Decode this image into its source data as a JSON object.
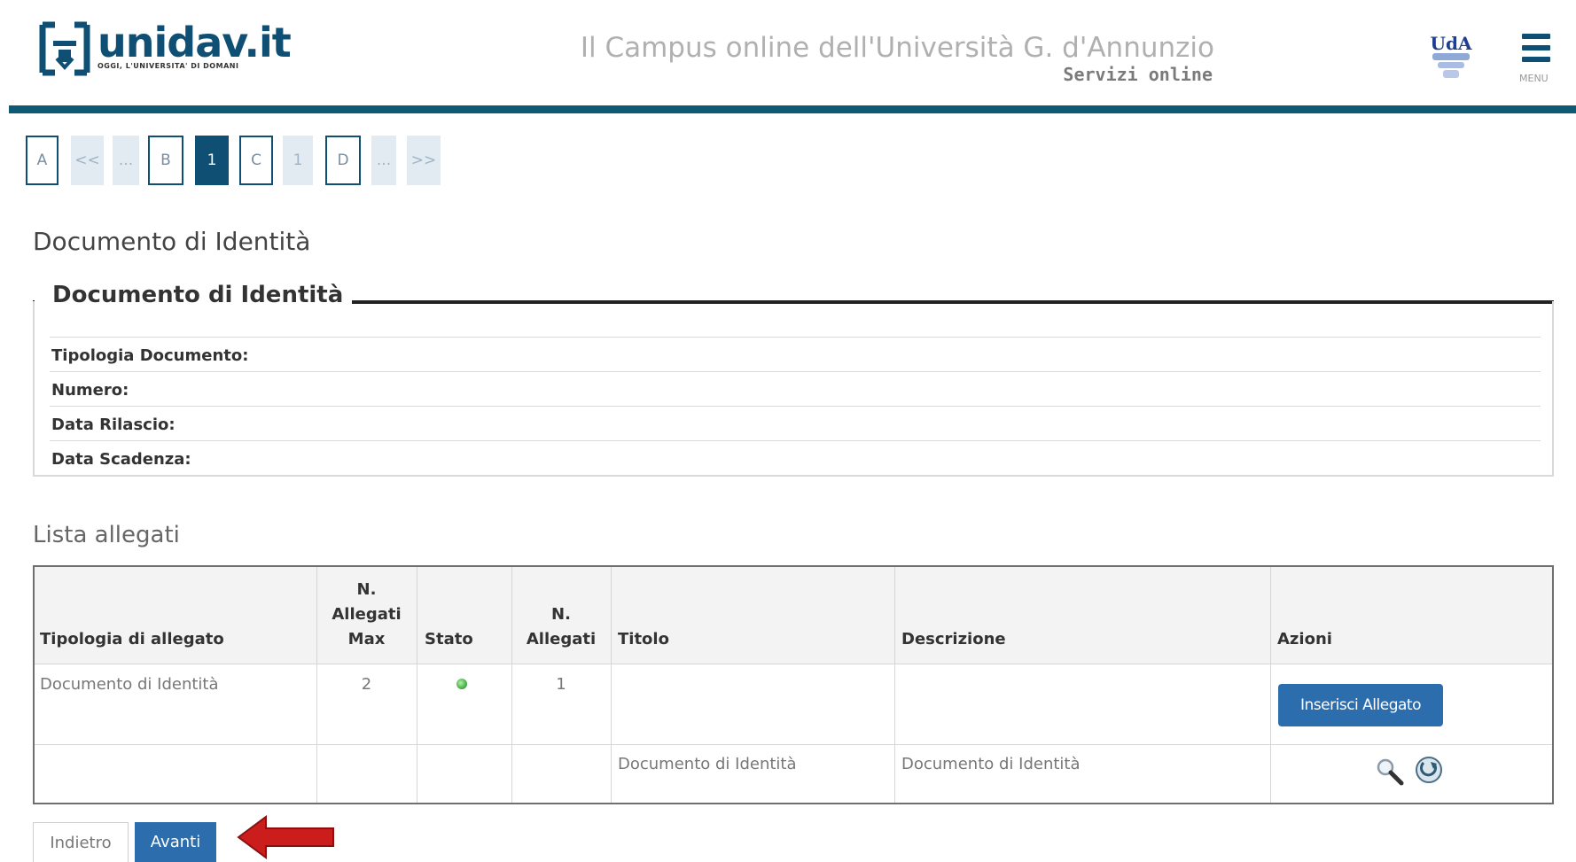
{
  "header": {
    "logo_name": "unidav.it",
    "logo_tagline": "OGGI, L'UNIVERSITA' DI DOMANI",
    "campus_title": "Il Campus online dell'Università G. d'Annunzio",
    "campus_subtitle": "Servizi online",
    "uda_logo_text": "UdA",
    "menu_label": "MENU"
  },
  "pager": {
    "items": [
      "A",
      "<<",
      "...",
      "B",
      "1",
      "C",
      "1",
      "D",
      "...",
      ">>"
    ],
    "active_index": 4
  },
  "page_title": "Documento di Identità",
  "identity_section": {
    "legend": "Documento di Identità",
    "fields": [
      {
        "label": "Tipologia Documento:",
        "value": ""
      },
      {
        "label": "Numero:",
        "value": ""
      },
      {
        "label": "Data Rilascio:",
        "value": ""
      },
      {
        "label": "Data Scadenza:",
        "value": ""
      }
    ]
  },
  "attachments": {
    "title": "Lista allegati",
    "headers": {
      "tipologia": "Tipologia di allegato",
      "max_line1": "N.",
      "max_line2": "Allegati",
      "max_line3": "Max",
      "stato": "Stato",
      "n_line1": "N.",
      "n_line2": "Allegati",
      "titolo": "Titolo",
      "descrizione": "Descrizione",
      "azioni": "Azioni"
    },
    "rows": [
      {
        "tipologia": "Documento di Identità",
        "max": "2",
        "stato": "green",
        "n": "1",
        "titolo": "",
        "descrizione": "",
        "action_label": "Inserisci Allegato"
      },
      {
        "tipologia": "",
        "max": "",
        "stato": "",
        "n": "",
        "titolo": "Documento di Identità",
        "descrizione": "Documento di Identità"
      }
    ],
    "status_color": "#4bb04b"
  },
  "footer": {
    "back_label": "Indietro",
    "next_label": "Avanti"
  },
  "colors": {
    "brand": "#0e4f73",
    "rule": "#0e5a75",
    "button": "#2b6dad",
    "arrow": "#cc1d1d"
  }
}
